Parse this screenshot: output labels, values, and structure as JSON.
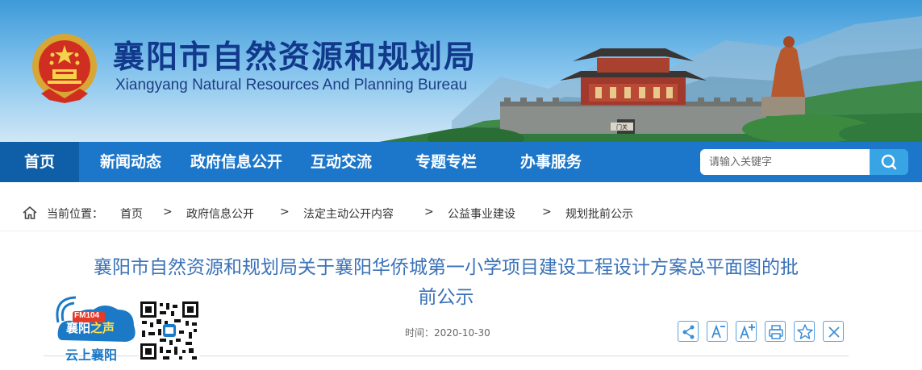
{
  "header": {
    "title_cn": "襄阳市自然资源和规划局",
    "title_en": "Xiangyang Natural Resources And Planning Bureau",
    "emblem_icon": "national-emblem-icon",
    "gate_plaque": "门关"
  },
  "nav": {
    "items": [
      {
        "label": "首页",
        "active": true
      },
      {
        "label": "新闻动态",
        "active": false
      },
      {
        "label": "政府信息公开",
        "active": false
      },
      {
        "label": "互动交流",
        "active": false
      },
      {
        "label": "专题专栏",
        "active": false
      },
      {
        "label": "办事服务",
        "active": false
      }
    ],
    "search_placeholder": "请输入关键字",
    "search_icon": "search-icon"
  },
  "breadcrumb": {
    "prefix": "当前位置：",
    "separator": ">",
    "items": [
      "首页",
      "政府信息公开",
      "法定主动公开内容",
      "公益事业建设",
      "规划批前公示"
    ]
  },
  "article": {
    "title_line1": "襄阳市自然资源和规划局关于襄阳华侨城第一小学项目建设工程设计方案总平面图的批",
    "title_line2": "前公示",
    "time_label": "时间：",
    "time_value": "2020-10-30"
  },
  "toolbar": {
    "items": [
      "share-icon",
      "font-decrease-icon",
      "font-increase-icon",
      "print-icon",
      "favorite-icon",
      "close-icon"
    ]
  },
  "radio": {
    "fm": "FM104",
    "name_a": "襄阳",
    "name_b": "之声",
    "sub": "云上襄阳"
  },
  "colors": {
    "nav_bg": "#1c76c9",
    "nav_active_bg": "#0f5ea8",
    "title_blue": "#3a72b8",
    "header_title": "#123a8c",
    "search_btn": "#38a4e4"
  }
}
